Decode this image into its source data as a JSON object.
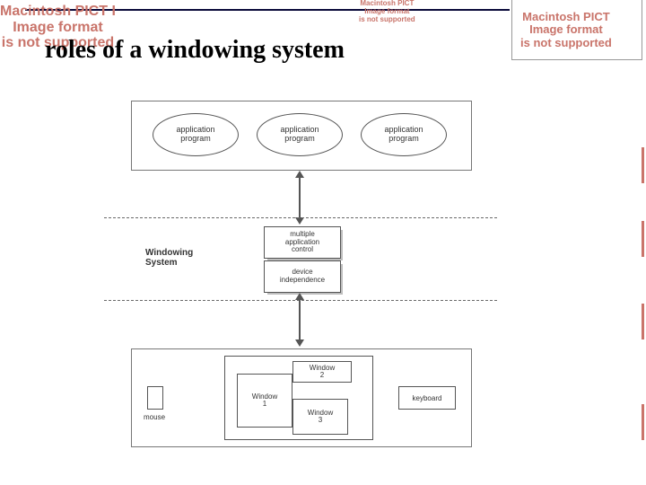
{
  "title": "roles of a windowing system",
  "pict_error_lines": "Macintosh PICT\nImage format\nis not supported",
  "pict_error_lines_left": "Macintosh PICT I\nImage format\nis not supported",
  "diagram": {
    "apps": {
      "e1": "application\nprogram",
      "e2": "application\nprogram",
      "e3": "application\nprogram"
    },
    "windowing_system_label": "Windowing\nSystem",
    "middle": {
      "m1": "multiple\napplication\ncontrol",
      "m2": "device\nindependence"
    },
    "devices": {
      "mouse": "mouse",
      "keyboard": "keyboard",
      "windows": {
        "w1": "Window\n1",
        "w2": "Window\n2",
        "w3": "Window\n3"
      }
    }
  },
  "chart_data": {
    "type": "diagram",
    "title": "roles of a windowing system",
    "top_layer": {
      "container": "application layer",
      "nodes": [
        "application program",
        "application program",
        "application program"
      ]
    },
    "middle_layer": {
      "label": "Windowing System",
      "nodes": [
        "multiple application control",
        "device independence"
      ]
    },
    "bottom_layer": {
      "container": "hardware / display layer",
      "nodes": [
        "mouse",
        "screen (Window 1, Window 2, Window 3)",
        "keyboard"
      ]
    },
    "edges": [
      {
        "from": "application layer",
        "to": "Windowing System",
        "style": "bidirectional"
      },
      {
        "from": "Windowing System",
        "to": "hardware / display layer",
        "style": "bidirectional"
      }
    ],
    "separators": [
      "dashed line above Windowing System",
      "dashed line below Windowing System"
    ]
  }
}
